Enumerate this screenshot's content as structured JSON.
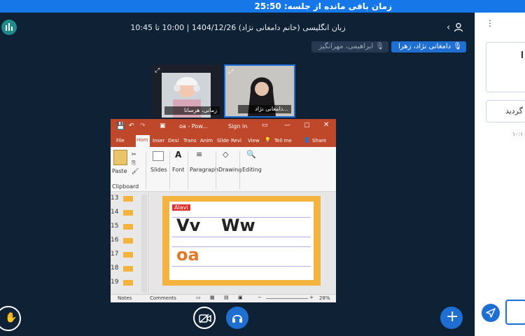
{
  "banner": {
    "text": "زمان باقی مانده از جلسه: 25:50"
  },
  "header": {
    "title": "زبان انگلیسی (خانم دامغانی نژاد) 1404/12/26 | 10:00 تا 10:45"
  },
  "presenters": {
    "active": "دامغانی نژاد، زهرا",
    "other": "ابراهیمی، مهرانگیز"
  },
  "tiles": [
    {
      "name": "زمانی، هرسانا"
    },
    {
      "name": "دامغانی نژاد..."
    }
  ],
  "ppt": {
    "title": "oa - Pow...",
    "signin": "Sign in",
    "tabs": [
      "File",
      "Hom",
      "Inser",
      "Desi",
      "Trans",
      "Anim",
      "Slide",
      "Revi",
      "View"
    ],
    "tellme": "Tell me",
    "share": "Share",
    "groups": [
      "Paste",
      "Slides",
      "Font",
      "Paragraph",
      "Drawing",
      "Editing"
    ],
    "clipboard_label": "Clipboard",
    "slide_numbers": [
      "13",
      "14",
      "15",
      "16",
      "17",
      "18",
      "19"
    ],
    "slide": {
      "tag": "Alavi",
      "letters1": "Vv",
      "letters2": "Ww",
      "letters3": "oa"
    },
    "status": {
      "notes": "Notes",
      "comments": "Comments",
      "zoom": "28%"
    }
  },
  "right_panel": {
    "menu_icon": "⋮",
    "box2_text": "گردید",
    "time": "۱۰:۱"
  },
  "colors": {
    "banner": "#1677e8",
    "bg": "#0f2235",
    "accent": "#1e6fd1",
    "ppt_red": "#c0482a",
    "slide_border": "#f3b33d"
  }
}
